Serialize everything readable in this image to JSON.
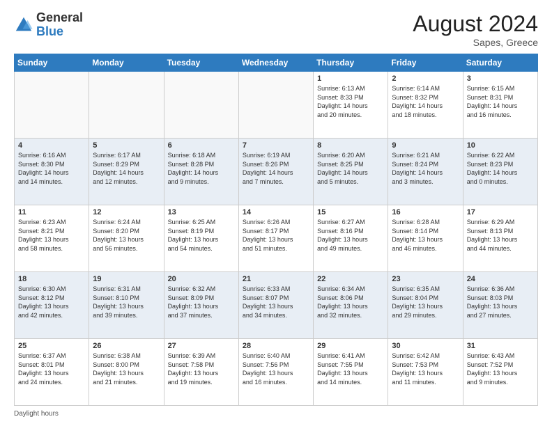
{
  "header": {
    "logo_general": "General",
    "logo_blue": "Blue",
    "month_year": "August 2024",
    "location": "Sapes, Greece"
  },
  "footer": {
    "note": "Daylight hours"
  },
  "weekdays": [
    "Sunday",
    "Monday",
    "Tuesday",
    "Wednesday",
    "Thursday",
    "Friday",
    "Saturday"
  ],
  "weeks": [
    [
      {
        "day": "",
        "info": ""
      },
      {
        "day": "",
        "info": ""
      },
      {
        "day": "",
        "info": ""
      },
      {
        "day": "",
        "info": ""
      },
      {
        "day": "1",
        "info": "Sunrise: 6:13 AM\nSunset: 8:33 PM\nDaylight: 14 hours\nand 20 minutes."
      },
      {
        "day": "2",
        "info": "Sunrise: 6:14 AM\nSunset: 8:32 PM\nDaylight: 14 hours\nand 18 minutes."
      },
      {
        "day": "3",
        "info": "Sunrise: 6:15 AM\nSunset: 8:31 PM\nDaylight: 14 hours\nand 16 minutes."
      }
    ],
    [
      {
        "day": "4",
        "info": "Sunrise: 6:16 AM\nSunset: 8:30 PM\nDaylight: 14 hours\nand 14 minutes."
      },
      {
        "day": "5",
        "info": "Sunrise: 6:17 AM\nSunset: 8:29 PM\nDaylight: 14 hours\nand 12 minutes."
      },
      {
        "day": "6",
        "info": "Sunrise: 6:18 AM\nSunset: 8:28 PM\nDaylight: 14 hours\nand 9 minutes."
      },
      {
        "day": "7",
        "info": "Sunrise: 6:19 AM\nSunset: 8:26 PM\nDaylight: 14 hours\nand 7 minutes."
      },
      {
        "day": "8",
        "info": "Sunrise: 6:20 AM\nSunset: 8:25 PM\nDaylight: 14 hours\nand 5 minutes."
      },
      {
        "day": "9",
        "info": "Sunrise: 6:21 AM\nSunset: 8:24 PM\nDaylight: 14 hours\nand 3 minutes."
      },
      {
        "day": "10",
        "info": "Sunrise: 6:22 AM\nSunset: 8:23 PM\nDaylight: 14 hours\nand 0 minutes."
      }
    ],
    [
      {
        "day": "11",
        "info": "Sunrise: 6:23 AM\nSunset: 8:21 PM\nDaylight: 13 hours\nand 58 minutes."
      },
      {
        "day": "12",
        "info": "Sunrise: 6:24 AM\nSunset: 8:20 PM\nDaylight: 13 hours\nand 56 minutes."
      },
      {
        "day": "13",
        "info": "Sunrise: 6:25 AM\nSunset: 8:19 PM\nDaylight: 13 hours\nand 54 minutes."
      },
      {
        "day": "14",
        "info": "Sunrise: 6:26 AM\nSunset: 8:17 PM\nDaylight: 13 hours\nand 51 minutes."
      },
      {
        "day": "15",
        "info": "Sunrise: 6:27 AM\nSunset: 8:16 PM\nDaylight: 13 hours\nand 49 minutes."
      },
      {
        "day": "16",
        "info": "Sunrise: 6:28 AM\nSunset: 8:14 PM\nDaylight: 13 hours\nand 46 minutes."
      },
      {
        "day": "17",
        "info": "Sunrise: 6:29 AM\nSunset: 8:13 PM\nDaylight: 13 hours\nand 44 minutes."
      }
    ],
    [
      {
        "day": "18",
        "info": "Sunrise: 6:30 AM\nSunset: 8:12 PM\nDaylight: 13 hours\nand 42 minutes."
      },
      {
        "day": "19",
        "info": "Sunrise: 6:31 AM\nSunset: 8:10 PM\nDaylight: 13 hours\nand 39 minutes."
      },
      {
        "day": "20",
        "info": "Sunrise: 6:32 AM\nSunset: 8:09 PM\nDaylight: 13 hours\nand 37 minutes."
      },
      {
        "day": "21",
        "info": "Sunrise: 6:33 AM\nSunset: 8:07 PM\nDaylight: 13 hours\nand 34 minutes."
      },
      {
        "day": "22",
        "info": "Sunrise: 6:34 AM\nSunset: 8:06 PM\nDaylight: 13 hours\nand 32 minutes."
      },
      {
        "day": "23",
        "info": "Sunrise: 6:35 AM\nSunset: 8:04 PM\nDaylight: 13 hours\nand 29 minutes."
      },
      {
        "day": "24",
        "info": "Sunrise: 6:36 AM\nSunset: 8:03 PM\nDaylight: 13 hours\nand 27 minutes."
      }
    ],
    [
      {
        "day": "25",
        "info": "Sunrise: 6:37 AM\nSunset: 8:01 PM\nDaylight: 13 hours\nand 24 minutes."
      },
      {
        "day": "26",
        "info": "Sunrise: 6:38 AM\nSunset: 8:00 PM\nDaylight: 13 hours\nand 21 minutes."
      },
      {
        "day": "27",
        "info": "Sunrise: 6:39 AM\nSunset: 7:58 PM\nDaylight: 13 hours\nand 19 minutes."
      },
      {
        "day": "28",
        "info": "Sunrise: 6:40 AM\nSunset: 7:56 PM\nDaylight: 13 hours\nand 16 minutes."
      },
      {
        "day": "29",
        "info": "Sunrise: 6:41 AM\nSunset: 7:55 PM\nDaylight: 13 hours\nand 14 minutes."
      },
      {
        "day": "30",
        "info": "Sunrise: 6:42 AM\nSunset: 7:53 PM\nDaylight: 13 hours\nand 11 minutes."
      },
      {
        "day": "31",
        "info": "Sunrise: 6:43 AM\nSunset: 7:52 PM\nDaylight: 13 hours\nand 9 minutes."
      }
    ]
  ]
}
